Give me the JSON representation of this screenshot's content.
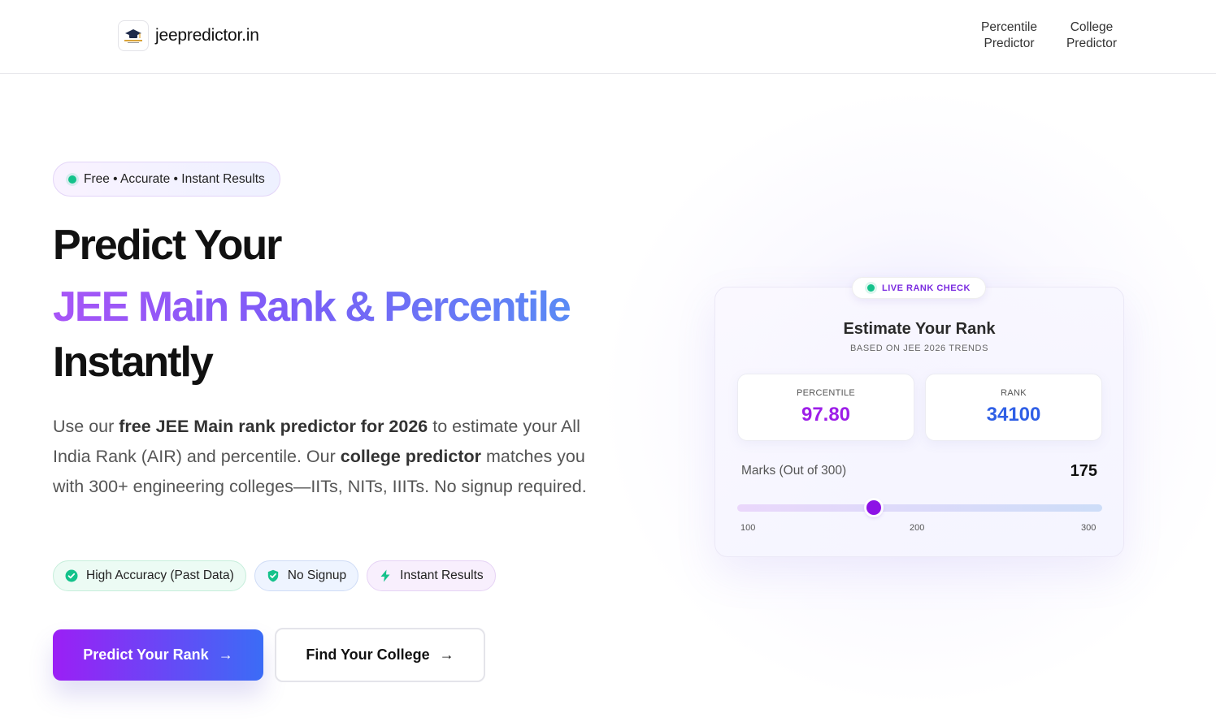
{
  "header": {
    "brand": "jeepredictor.in",
    "logo_icon": "graduation-cap-icon",
    "nav": [
      {
        "line1": "Percentile",
        "line2": "Predictor"
      },
      {
        "line1": "College",
        "line2": "Predictor"
      }
    ]
  },
  "hero": {
    "pill": "Free • Accurate • Instant Results",
    "headline_line1": "Predict Your",
    "headline_line2": "JEE Main Rank & Percentile",
    "headline_line3": "Instantly",
    "desc": {
      "p1": "Use our ",
      "b1": "free JEE Main rank predictor for 2026",
      "p2": " to estimate your All India Rank (AIR) and percentile. Our ",
      "b2": "college predictor",
      "p3": " matches you with 300+ engineering colleges—IITs, NITs, IIITs. No signup required."
    },
    "chips": [
      {
        "label": "High Accuracy (Past Data)",
        "icon": "check-circle-icon",
        "color": "#14c28b"
      },
      {
        "label": "No Signup",
        "icon": "shield-check-icon",
        "color": "#14c28b"
      },
      {
        "label": "Instant Results",
        "icon": "lightning-icon",
        "color": "#14c28b"
      }
    ],
    "primary_button": "Predict Your Rank",
    "secondary_button": "Find Your College",
    "button_arrow": "→"
  },
  "card": {
    "badge": "LIVE RANK CHECK",
    "title": "Estimate Your Rank",
    "subtitle": "BASED ON JEE 2026 TRENDS",
    "percentile_label": "PERCENTILE",
    "percentile_value": "97.80",
    "rank_label": "RANK",
    "rank_value": "34100",
    "marks_label": "Marks (Out of 300)",
    "marks_value": "175",
    "slider": {
      "min": 100,
      "max": 300,
      "value": 175,
      "ticks": [
        "100",
        "200",
        "300"
      ]
    }
  },
  "colors": {
    "accent_purple": "#9b1ff5",
    "accent_blue": "#3b6cf6",
    "status_green": "#14c28b"
  }
}
